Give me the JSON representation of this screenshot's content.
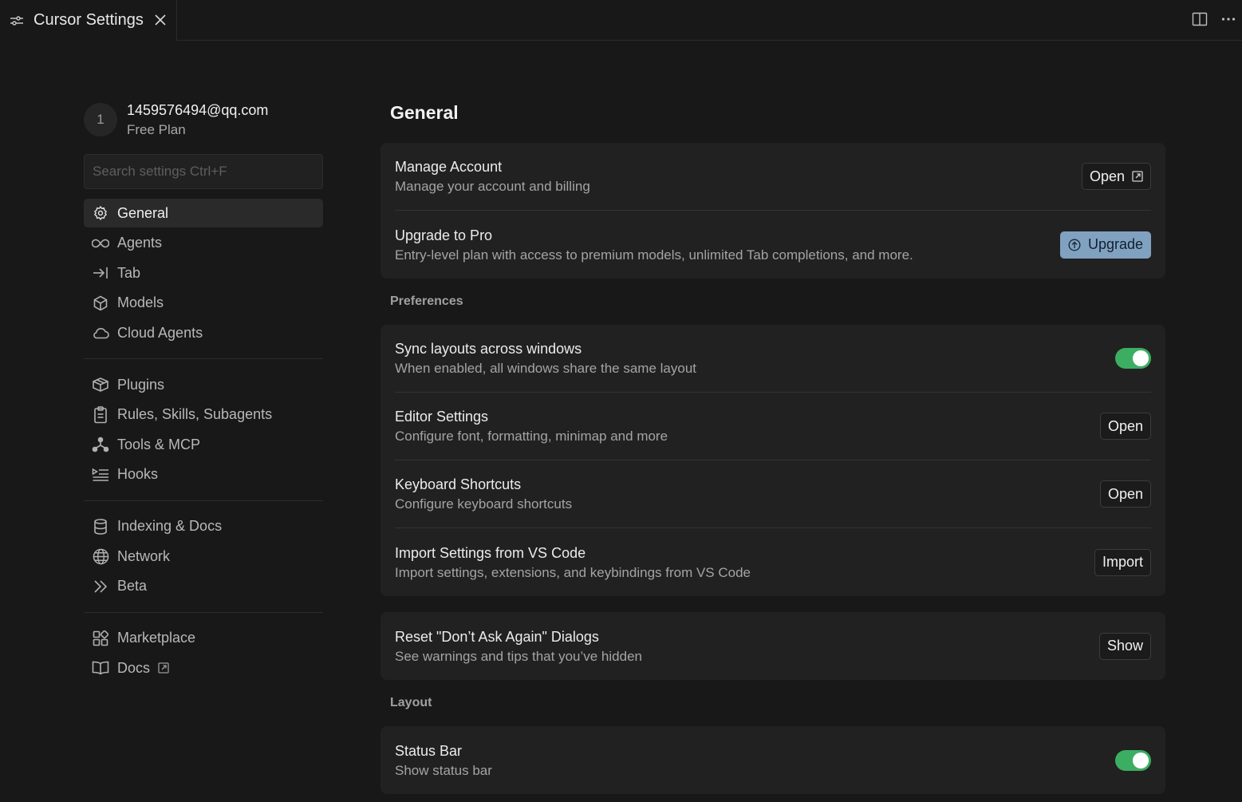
{
  "tab": {
    "title": "Cursor Settings"
  },
  "account": {
    "avatar_initial": "1",
    "email": "1459576494@qq.com",
    "plan": "Free Plan"
  },
  "search": {
    "placeholder": "Search settings Ctrl+F"
  },
  "sidebar": {
    "groups": [
      [
        {
          "label": "General",
          "icon": "gear-icon",
          "active": true
        },
        {
          "label": "Agents",
          "icon": "infinity-icon"
        },
        {
          "label": "Tab",
          "icon": "arrow-to-line-icon"
        },
        {
          "label": "Models",
          "icon": "cube-icon"
        },
        {
          "label": "Cloud Agents",
          "icon": "cloud-icon"
        }
      ],
      [
        {
          "label": "Plugins",
          "icon": "package-icon"
        },
        {
          "label": "Rules, Skills, Subagents",
          "icon": "clipboard-icon"
        },
        {
          "label": "Tools & MCP",
          "icon": "network-nodes-icon"
        },
        {
          "label": "Hooks",
          "icon": "list-play-icon"
        }
      ],
      [
        {
          "label": "Indexing & Docs",
          "icon": "database-icon"
        },
        {
          "label": "Network",
          "icon": "globe-icon"
        },
        {
          "label": "Beta",
          "icon": "double-chevron-icon"
        }
      ],
      [
        {
          "label": "Marketplace",
          "icon": "blocks-icon"
        },
        {
          "label": "Docs",
          "icon": "book-icon",
          "external": true
        }
      ]
    ]
  },
  "main": {
    "title": "General",
    "account_card": {
      "manage": {
        "title": "Manage Account",
        "desc": "Manage your account and billing",
        "button": "Open"
      },
      "upgrade": {
        "title": "Upgrade to Pro",
        "desc": "Entry-level plan with access to premium models, unlimited Tab completions, and more.",
        "button": "Upgrade"
      }
    },
    "preferences_label": "Preferences",
    "preferences": {
      "sync": {
        "title": "Sync layouts across windows",
        "desc": "When enabled, all windows share the same layout",
        "enabled": true
      },
      "editor": {
        "title": "Editor Settings",
        "desc": "Configure font, formatting, minimap and more",
        "button": "Open"
      },
      "keyboard": {
        "title": "Keyboard Shortcuts",
        "desc": "Configure keyboard shortcuts",
        "button": "Open"
      },
      "import": {
        "title": "Import Settings from VS Code",
        "desc": "Import settings, extensions, and keybindings from VS Code",
        "button": "Import"
      }
    },
    "reset": {
      "title": "Reset \"Don’t Ask Again\" Dialogs",
      "desc": "See warnings and tips that you’ve hidden",
      "button": "Show"
    },
    "layout_label": "Layout",
    "layout": {
      "status_bar": {
        "title": "Status Bar",
        "desc": "Show status bar",
        "enabled": true
      }
    }
  },
  "colors": {
    "background": "#181818",
    "card": "#212121",
    "toggle_on": "#3cae62",
    "upgrade_button": "#81a1c1"
  }
}
